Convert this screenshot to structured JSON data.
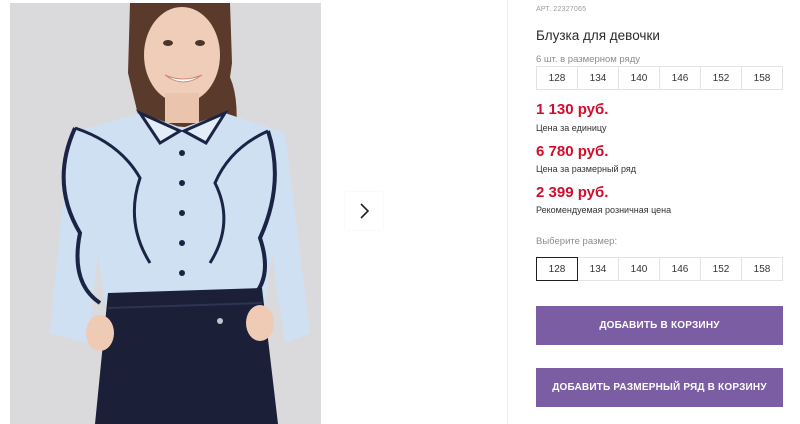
{
  "gallery": {
    "next_icon": "chevron-right-icon"
  },
  "product": {
    "article": "АРТ. 22327065",
    "title": "Блузка для девочки",
    "pack_label": "6 шт. в размерном ряду",
    "pack_sizes": [
      "128",
      "134",
      "140",
      "146",
      "152",
      "158"
    ],
    "prices": [
      {
        "value": "1 130 руб.",
        "note": "Цена за единицу"
      },
      {
        "value": "6 780 руб.",
        "note": "Цена за размерный ряд"
      },
      {
        "value": "2 399 руб.",
        "note": "Рекомендуемая розничная цена"
      }
    ],
    "choose_size_label": "Выберите размер:",
    "selectable_sizes": [
      "128",
      "134",
      "140",
      "146",
      "152",
      "158"
    ],
    "selected_size": "128",
    "add_to_cart_label": "ДОБАВИТЬ В КОРЗИНУ",
    "add_row_to_cart_label": "ДОБАВИТЬ РАЗМЕРНЫЙ РЯД В КОРЗИНУ"
  },
  "colors": {
    "price": "#d40c2c",
    "button": "#7b5da3",
    "blouse": "#cfe0f3",
    "trim": "#1b2444"
  }
}
